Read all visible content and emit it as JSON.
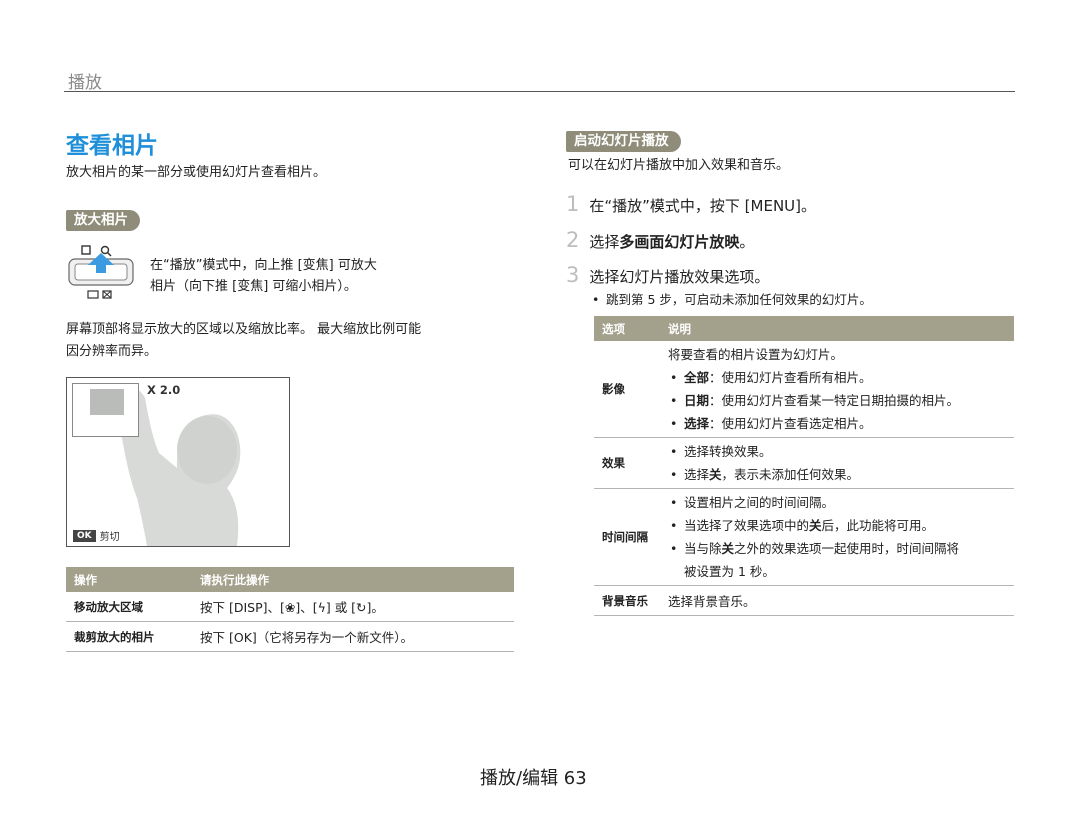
{
  "header": {
    "section": "播放"
  },
  "left": {
    "title": "查看相片",
    "intro": "放大相片的某一部分或使用幻灯片查看相片。",
    "zoom_pill": "放大相片",
    "zoom_text_1": "在“播放”模式中，向上推 [变焦] 可放大",
    "zoom_text_2": "相片（向下推 [变焦] 可缩小相片）。",
    "zoom_note_1": "屏幕顶部将显示放大的区域以及缩放比率。 最大缩放比例可能",
    "zoom_note_2": "因分辨率而异。",
    "screen": {
      "zoom_ratio": "X 2.0",
      "ok_label": "OK",
      "crop_label": "剪切"
    },
    "table": {
      "headers": [
        "操作",
        "请执行此操作"
      ],
      "rows": [
        {
          "action": "移动放大区域",
          "instruction": "按下 [DISP]、[❀]、[ϟ] 或 [↻]。"
        },
        {
          "action": "裁剪放大的相片",
          "instruction": "按下 [OK]（它将另存为一个新文件）。"
        }
      ]
    }
  },
  "right": {
    "slideshow_pill": "启动幻灯片播放",
    "intro": "可以在幻灯片播放中加入效果和音乐。",
    "steps": [
      {
        "num": "1",
        "text": "在“播放”模式中，按下 [MENU]。"
      },
      {
        "num": "2",
        "text_pre": "选择",
        "text_bold": "多画面幻灯片放映",
        "text_post": "。"
      },
      {
        "num": "3",
        "text": "选择幻灯片播放效果选项。"
      }
    ],
    "step3_bullet": "跳到第 5 步，可启动未添加任何效果的幻灯片。",
    "table": {
      "headers": [
        "选项",
        "说明"
      ],
      "image": {
        "label": "影像",
        "lead": "将要查看的相片设置为幻灯片。",
        "b1_bold": "全部",
        "b1": "：使用幻灯片查看所有相片。",
        "b2_bold": "日期",
        "b2": "：使用幻灯片查看某一特定日期拍摄的相片。",
        "b3_bold": "选择",
        "b3": "：使用幻灯片查看选定相片。"
      },
      "effect": {
        "label": "效果",
        "b1": "选择转换效果。",
        "b2_pre": "选择",
        "b2_bold": "关",
        "b2_post": "，表示未添加任何效果。"
      },
      "interval": {
        "label": "时间间隔",
        "b1": "设置相片之间的时间间隔。",
        "b2_pre": "当选择了效果选项中的",
        "b2_bold": "关",
        "b2_post": "后，此功能将可用。",
        "b3_pre": "当与除",
        "b3_bold": "关",
        "b3_post": "之外的效果选项一起使用时，时间间隔将",
        "b3_cont": "被设置为 1 秒。"
      },
      "music": {
        "label": "背景音乐",
        "desc": "选择背景音乐。"
      }
    }
  },
  "footer": {
    "page": "播放/编辑 63"
  }
}
